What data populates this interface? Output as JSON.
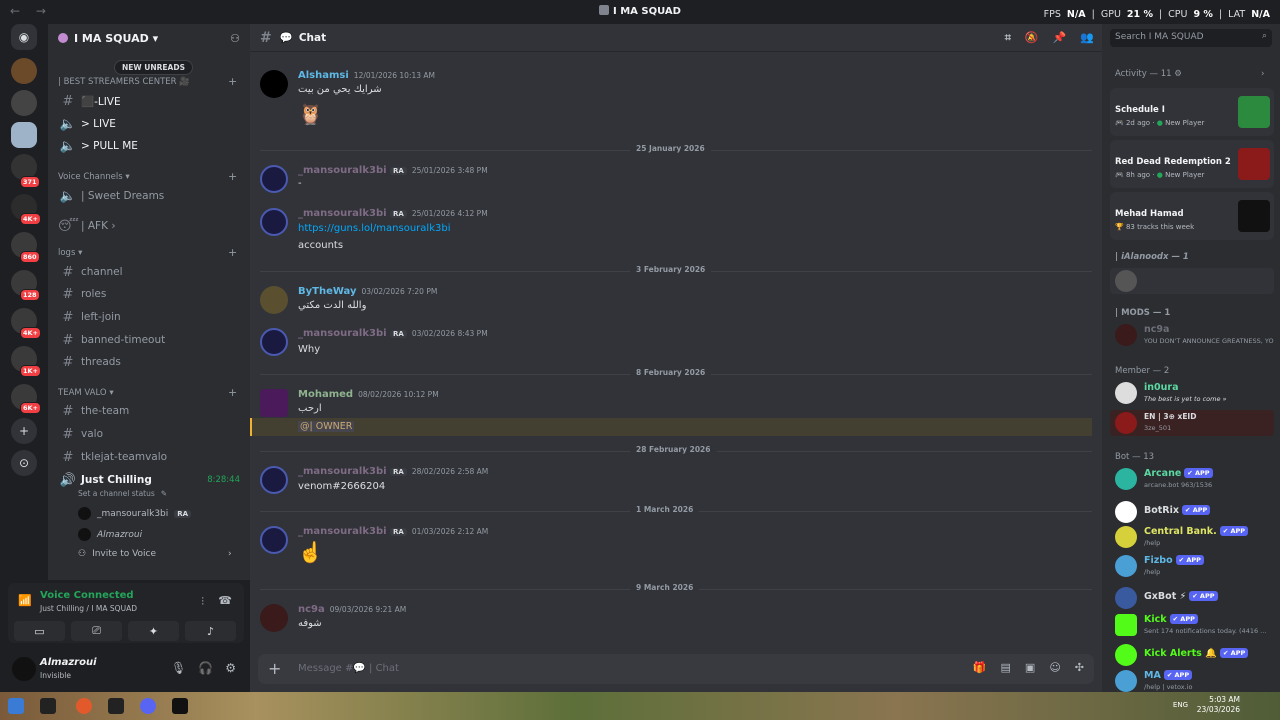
{
  "window": {
    "title": "I MA SQUAD",
    "nav": "← →"
  },
  "perf": {
    "fps_label": "FPS",
    "fps": "N/A",
    "gpu_label": "GPU",
    "gpu": "21 %",
    "cpu_label": "CPU",
    "cpu": "9 %",
    "lat_label": "LAT",
    "lat": "N/A"
  },
  "rail": {
    "badges": [
      "371",
      "4K+",
      "860",
      "128",
      "4K+",
      "1K+",
      "6K+"
    ]
  },
  "server": {
    "name": "I MA SQUAD",
    "new_unreads": "NEW UNREADS"
  },
  "channels": {
    "cat_streamers": "| BEST STREAMERS CENTER 🎥",
    "live": "⬛‑LIVE",
    "live2": "> LIVE",
    "pull": "> PULL ME",
    "cat_voice": "Voice Channels",
    "sweet": "| Sweet Dreams",
    "afk": "| AFK",
    "cat_logs": "logs",
    "logs": [
      "channel",
      "roles",
      "left-join",
      "banned-timeout",
      "threads"
    ],
    "cat_valo": "TEAM VALO",
    "valo": [
      "the-team",
      "valo",
      "tklejat-teamvalo"
    ],
    "just": "Just Chilling",
    "just_timer": "8:28:44",
    "status_hint": "Set a channel status",
    "vusers": [
      "_mansouralk3bi",
      "Almazroui"
    ],
    "vuser_tag": "RA",
    "invite": "Invite to Voice"
  },
  "voice": {
    "connected": "Voice Connected",
    "where": "Just Chilling / I MA SQUAD"
  },
  "user": {
    "name": "Almazroui",
    "status": "Invisible"
  },
  "chat": {
    "channel": "Chat",
    "messages": [
      {
        "author": "Alshamsi",
        "time": "12/01/2026 10:13 AM",
        "text": "شرايك يحي من بيت",
        "extra": "🦉"
      },
      {
        "divider": "25 January 2026"
      },
      {
        "author": "_mansouralk3bi",
        "tag": "RA",
        "time": "25/01/2026 3:48 PM",
        "text": "-"
      },
      {
        "author": "_mansouralk3bi",
        "tag": "RA",
        "time": "25/01/2026 4:12 PM",
        "link": "https://guns.lol/mansouralk3bi",
        "text": "accounts"
      },
      {
        "divider": "3 February 2026"
      },
      {
        "author": "ByTheWay",
        "time": "03/02/2026 7:20 PM",
        "text": "والله الدت مكتي"
      },
      {
        "author": "_mansouralk3bi",
        "tag": "RA",
        "time": "03/02/2026 8:43 PM",
        "text": "Why"
      },
      {
        "divider": "8 February 2026"
      },
      {
        "author": "Mohamed",
        "time": "08/02/2026 10:12 PM",
        "text": "ارحب",
        "mention": "@| OWNER"
      },
      {
        "divider": "28 February 2026"
      },
      {
        "author": "_mansouralk3bi",
        "tag": "RA",
        "time": "28/02/2026 2:58 AM",
        "text": "venom#2666204"
      },
      {
        "divider": "1 March 2026"
      },
      {
        "author": "_mansouralk3bi",
        "tag": "RA",
        "time": "01/03/2026 2:12 AM",
        "text": "☝️"
      },
      {
        "divider": "9 March 2026"
      },
      {
        "author": "nc9a",
        "time": "09/03/2026 9:21 AM",
        "text": "شوفه"
      }
    ],
    "input_placeholder": "Message #💬 | Chat"
  },
  "sidebar": {
    "search": "Search I MA SQUAD",
    "activity": "Activity — 11",
    "acts": [
      {
        "title": "Schedule I",
        "ago": "2d ago",
        "sub": "New Player"
      },
      {
        "title": "Red Dead Redemption 2",
        "ago": "8h ago",
        "sub": "New Player"
      },
      {
        "title": "Mehad Hamad",
        "sub": "83 tracks this week"
      }
    ],
    "grp_alanoodx": "| iAlanoodx — 1",
    "grp_mods": "| MODS — 1",
    "mods": [
      {
        "name": "nc9a",
        "sub": "YOU DON'T ANNOUNCE GREATNESS, YOU..."
      }
    ],
    "grp_member": "Member — 2",
    "members": [
      {
        "name": "in0ura",
        "sub": "The best is yet to come »"
      },
      {
        "name": "EN | 3⊕ xEID",
        "sub": "3ze_501"
      }
    ],
    "grp_bot": "Bot — 13",
    "bots": [
      {
        "name": "Arcane",
        "sub": "arcane.bot 963/1536",
        "color": "#5cd8a2"
      },
      {
        "name": "BotRix",
        "sub": "",
        "color": "#dbdee1"
      },
      {
        "name": "Central Bank.",
        "sub": "/help",
        "color": "#dfe563"
      },
      {
        "name": "Fizbo",
        "sub": "/help",
        "color": "#5fb8e6"
      },
      {
        "name": "GxBot ⚡",
        "sub": "",
        "color": "#dbdee1"
      },
      {
        "name": "Kick",
        "sub": "Sent 174 notifications today. (4416 ...",
        "color": "#53fc18"
      },
      {
        "name": "Kick Alerts 🔔",
        "sub": "",
        "color": "#53fc18"
      },
      {
        "name": "MA",
        "sub": "/help | vetox.io",
        "color": "#5fb8e6"
      }
    ],
    "app_label": "✔ APP"
  },
  "taskbar": {
    "time": "5:03 AM",
    "date": "23/03/2026",
    "lang": "ENG"
  }
}
